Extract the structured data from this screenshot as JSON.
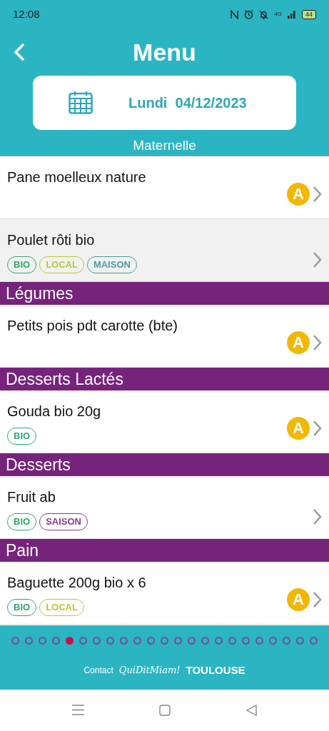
{
  "status_bar": {
    "time": "12:08",
    "network": "4G",
    "battery": "44"
  },
  "header": {
    "title": "Menu",
    "date": "Lundi  04/12/2023",
    "group": "Maternelle"
  },
  "sections": [
    {
      "items": [
        {
          "name": "Pane moelleux nature",
          "selected": false,
          "allergen": "A"
        }
      ]
    },
    {
      "items": [
        {
          "name": "Poulet rôti bio",
          "selected": true,
          "tags": [
            {
              "label": "BIO",
              "color": "#2ea86a"
            },
            {
              "label": "LOCAL",
              "color": "#b6c935"
            },
            {
              "label": "MAISON",
              "color": "#4b9c9c"
            }
          ]
        }
      ]
    },
    {
      "title": "Légumes",
      "items": [
        {
          "name": "Petits pois pdt carotte (bte)",
          "selected": false,
          "allergen": "A"
        }
      ]
    },
    {
      "title": "Desserts Lactés",
      "items": [
        {
          "name": "Gouda bio 20g",
          "selected": false,
          "allergen": "A",
          "tags": [
            {
              "label": "BIO",
              "color": "#2ea86a"
            }
          ]
        }
      ]
    },
    {
      "title": "Desserts",
      "items": [
        {
          "name": "Fruit ab",
          "selected": false,
          "tags": [
            {
              "label": "BIO",
              "color": "#2ea86a"
            },
            {
              "label": "SAISON",
              "color": "#8c3a8c"
            }
          ]
        }
      ]
    },
    {
      "title": "Pain",
      "items": [
        {
          "name": "Baguette 200g bio x 6",
          "selected": false,
          "allergen": "A",
          "tags": [
            {
              "label": "BIO",
              "color": "#2ea86a"
            },
            {
              "label": "LOCAL",
              "color": "#b6c935"
            }
          ]
        }
      ]
    }
  ],
  "pager": [
    {
      "selected": false
    },
    {
      "selected": false
    },
    {
      "selected": false
    },
    {
      "selected": false
    },
    {
      "selected": true
    },
    {
      "selected": false
    },
    {
      "selected": false
    },
    {
      "selected": false
    },
    {
      "selected": false
    },
    {
      "selected": false
    },
    {
      "selected": false
    },
    {
      "selected": false
    },
    {
      "selected": false
    },
    {
      "selected": false
    },
    {
      "selected": false
    },
    {
      "selected": false
    },
    {
      "selected": false
    },
    {
      "selected": false
    },
    {
      "selected": false
    },
    {
      "selected": false
    },
    {
      "selected": false
    },
    {
      "selected": false
    },
    {
      "selected": false
    }
  ],
  "footer": {
    "contact": "Contact",
    "logo_script": "QuiDitMiam!",
    "logo_city": "TOULOUSE"
  }
}
